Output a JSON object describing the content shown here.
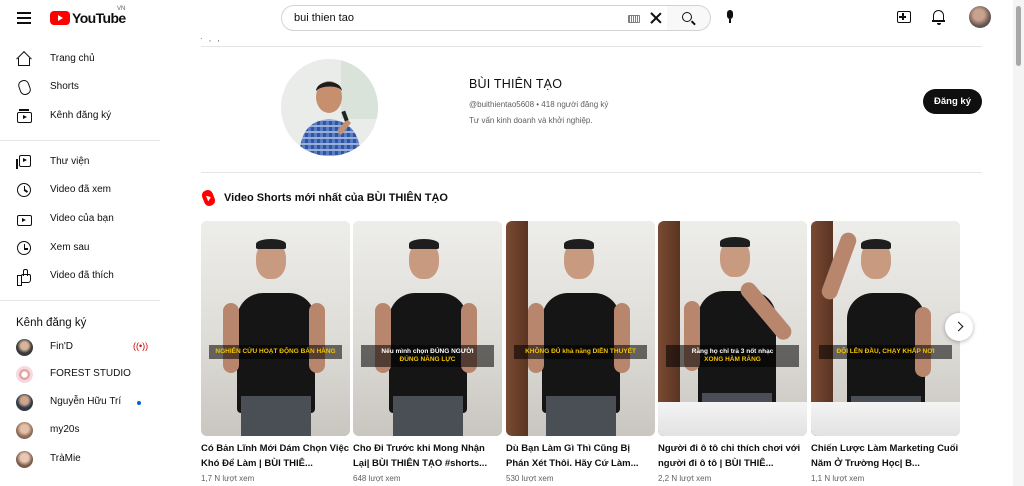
{
  "header": {
    "logo_text": "YouTube",
    "region": "VN",
    "search_value": "bui thien tao"
  },
  "sidebar": {
    "items": [
      {
        "label": "Trang chủ",
        "icon": "home-icon"
      },
      {
        "label": "Shorts",
        "icon": "shorts-icon"
      },
      {
        "label": "Kênh đăng ký",
        "icon": "subscriptions-icon"
      },
      {
        "label": "Thư viện",
        "icon": "library-icon"
      },
      {
        "label": "Video đã xem",
        "icon": "history-icon"
      },
      {
        "label": "Video của bạn",
        "icon": "your-videos-icon"
      },
      {
        "label": "Xem sau",
        "icon": "watch-later-icon"
      },
      {
        "label": "Video đã thích",
        "icon": "liked-videos-icon"
      }
    ],
    "subscriptions_title": "Kênh đăng ký",
    "subscriptions": [
      {
        "name": "Fin'D",
        "live": "((•))"
      },
      {
        "name": "FOREST STUDIO"
      },
      {
        "name": "Nguyễn Hữu Trí"
      },
      {
        "name": "my20s"
      },
      {
        "name": "TràMie"
      }
    ]
  },
  "channel": {
    "cut_text": "· , ,",
    "name": "BÙI THIÊN TẠO",
    "meta": "@buithientao5608 • 418 người đăng ký",
    "description": "Tư vấn kinh doanh và khởi nghiệp.",
    "subscribe_label": "Đăng ký"
  },
  "shorts_section": {
    "title": "Video Shorts mới nhất của BÙI THIÊN TẠO",
    "items": [
      {
        "title": "Có Bản Lĩnh Mới Dám Chọn Việc Khó Để Làm | BÙI THIÊ...",
        "views": "1,7 N lượt xem",
        "caption_a": "NGHIÊN CỨU HOẠT ĐỘNG BÁN HÀNG",
        "caption_b": ""
      },
      {
        "title": "Cho Đi Trước khi Mong Nhận Lại| BÙI THIÊN TẠO #shorts...",
        "views": "648 lượt xem",
        "caption_a": "Nếu mình chọn ĐÚNG NGƯỜI",
        "caption_b": "ĐÚNG NĂNG LỰC"
      },
      {
        "title": "Dù Bạn Làm Gì Thì Cũng Bị Phán Xét Thôi. Hãy Cứ Làm...",
        "views": "530 lượt xem",
        "caption_a": "KHÔNG ĐỦ khả năng DIỄN THUYẾT",
        "caption_b": ""
      },
      {
        "title": "Người đi ô tô chỉ thích chơi với người đi ô tô | BÙI THIÊ...",
        "views": "2,2 N lượt xem",
        "caption_a": "Rằng họ chỉ trả 3 nốt nhạc",
        "caption_b": "XONG HÀM RĂNG"
      },
      {
        "title": "Chiến Lược Làm Marketing Cuối Năm Ở Trường Học| B...",
        "views": "1,1 N lượt xem",
        "caption_a": "ĐỘI LÊN ĐẦU, CHẠY KHẮP NƠI",
        "caption_b": ""
      }
    ]
  },
  "colors": {
    "brand_red": "#ff0000",
    "caption_yellow": "#f2c200",
    "text_primary": "#0f0f0f",
    "text_secondary": "#606060"
  }
}
